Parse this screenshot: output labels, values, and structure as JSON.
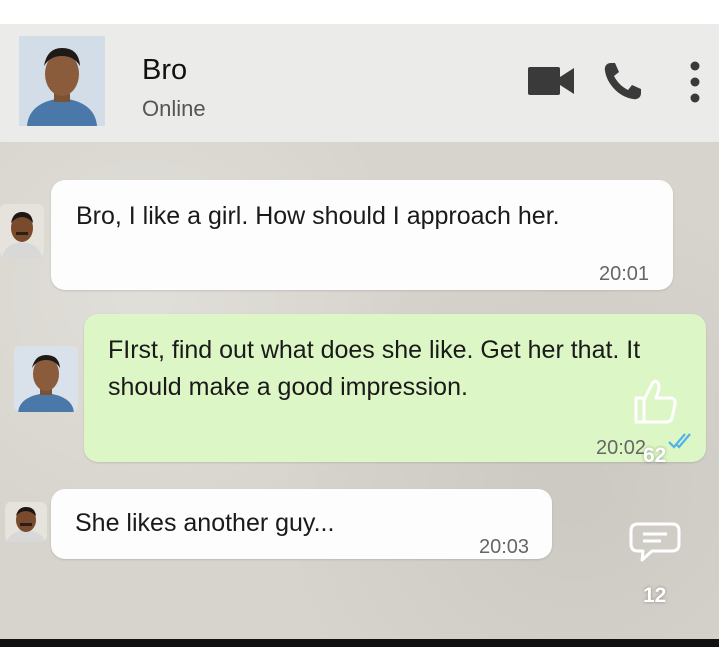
{
  "header": {
    "contact_name": "Bro",
    "status": "Online",
    "icons": [
      "video-call-icon",
      "voice-call-icon",
      "more-options-icon"
    ]
  },
  "messages": [
    {
      "direction": "incoming",
      "text": "Bro, I like a girl. How should I approach her.",
      "time": "20:01"
    },
    {
      "direction": "outgoing",
      "text": "FIrst, find out what does she like. Get her that. It should make a good impression.",
      "time": "20:02",
      "status_icon": "double-check-icon"
    },
    {
      "direction": "incoming",
      "text": "She likes another guy...",
      "time": "20:03"
    }
  ],
  "overlay": {
    "like_count": "62",
    "comment_count": "12"
  },
  "colors": {
    "header_bg": "#ebebe9",
    "chat_bg": "#d7d4cd",
    "incoming_bubble": "#fdfdfd",
    "outgoing_bubble": "#dcf7c5",
    "icon_dark": "#3a3a3a",
    "read_ticks": "#4fb3e8"
  }
}
